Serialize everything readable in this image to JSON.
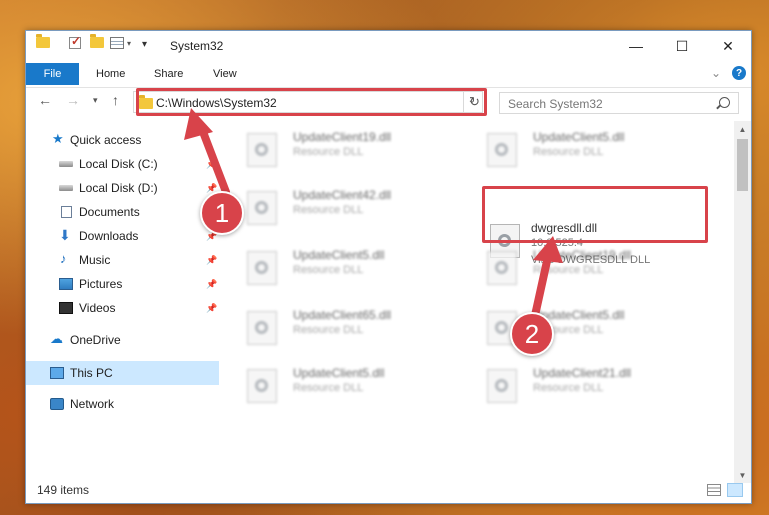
{
  "window": {
    "title": "System32"
  },
  "ribbon": {
    "tabs": [
      "File",
      "Home",
      "Share",
      "View"
    ],
    "help_label": "?"
  },
  "address_bar": {
    "path": "C:\\Windows\\System32"
  },
  "search": {
    "placeholder": "Search System32"
  },
  "sidebar": {
    "items": [
      {
        "label": "Quick access",
        "icon": "star-icon",
        "pinned": false
      },
      {
        "label": "Local Disk (C:)",
        "icon": "drive-icon",
        "pinned": true
      },
      {
        "label": "Local Disk (D:)",
        "icon": "drive-icon",
        "pinned": true
      },
      {
        "label": "Documents",
        "icon": "documents-icon",
        "pinned": true
      },
      {
        "label": "Downloads",
        "icon": "downloads-icon",
        "pinned": true
      },
      {
        "label": "Music",
        "icon": "music-icon",
        "pinned": true
      },
      {
        "label": "Pictures",
        "icon": "pictures-icon",
        "pinned": true
      },
      {
        "label": "Videos",
        "icon": "videos-icon",
        "pinned": true
      },
      {
        "label": "OneDrive",
        "icon": "onedrive-icon",
        "pinned": false
      },
      {
        "label": "This PC",
        "icon": "this-pc-icon",
        "pinned": false,
        "selected": true
      },
      {
        "label": "Network",
        "icon": "network-icon",
        "pinned": false
      }
    ]
  },
  "files": {
    "left": [
      {
        "name": "UpdateClient19.dll",
        "type": "Resource DLL"
      },
      {
        "name": "UpdateClient42.dll",
        "type": "Resource DLL"
      },
      {
        "name": "UpdateClient5.dll",
        "type": "Resource DLL"
      },
      {
        "name": "UpdateClient65.dll",
        "type": "Resource DLL"
      },
      {
        "name": "UpdateClient5.dll",
        "type": "Resource DLL"
      }
    ],
    "right": [
      {
        "name": "UpdateClient5.dll",
        "type": "Resource DLL"
      },
      {
        "name": "UpdateClient19.dll",
        "type": "Resource DLL"
      },
      {
        "name": "UpdateClient5.dll",
        "type": "Resource DLL"
      },
      {
        "name": "UpdateClient21.dll",
        "type": "Resource DLL"
      }
    ],
    "highlighted": {
      "name": "dwgresdll.dll",
      "version": "10.0.525.4",
      "description": "Visio DWGRESDLL DLL"
    }
  },
  "status": {
    "item_count": "149 items"
  },
  "callouts": {
    "step1": "1",
    "step2": "2",
    "color": "#d8434a"
  }
}
